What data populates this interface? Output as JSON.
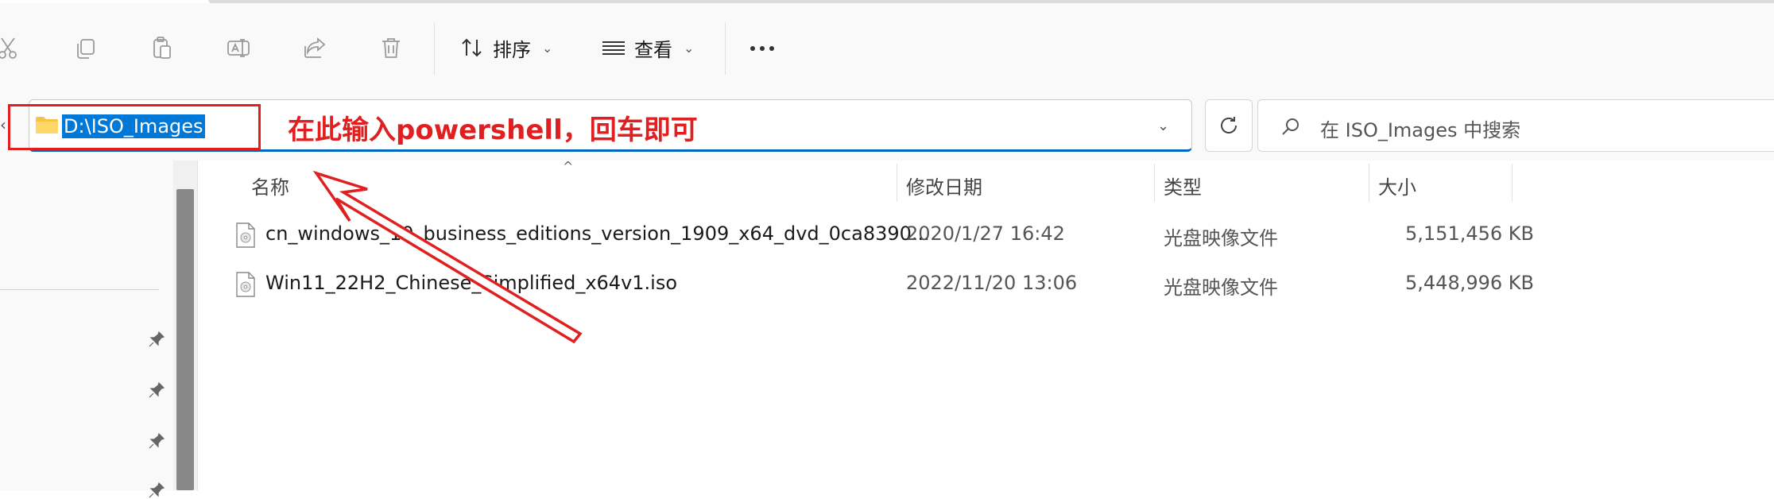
{
  "toolbar": {
    "icons": [
      "cut-icon",
      "copy-icon",
      "paste-icon",
      "rename-icon",
      "share-icon",
      "delete-icon"
    ],
    "sort_label": "排序",
    "view_label": "查看"
  },
  "address": {
    "path": "D:\\ISO_Images",
    "annotation": "在此输入powershell，回车即可"
  },
  "search": {
    "placeholder": "在 ISO_Images 中搜索"
  },
  "columns": {
    "name": "名称",
    "date": "修改日期",
    "type": "类型",
    "size": "大小"
  },
  "files": [
    {
      "name": "cn_windows_10_business_editions_version_1909_x64_dvd_0ca8390...",
      "date": "2020/1/27 16:42",
      "type": "光盘映像文件",
      "size": "5,151,456 KB"
    },
    {
      "name": "Win11_22H2_Chinese_Simplified_x64v1.iso",
      "date": "2022/11/20 13:06",
      "type": "光盘映像文件",
      "size": "5,448,996 KB"
    }
  ],
  "colors": {
    "accent": "#0067c0",
    "annotation": "#e02020",
    "selection": "#0078d7"
  }
}
